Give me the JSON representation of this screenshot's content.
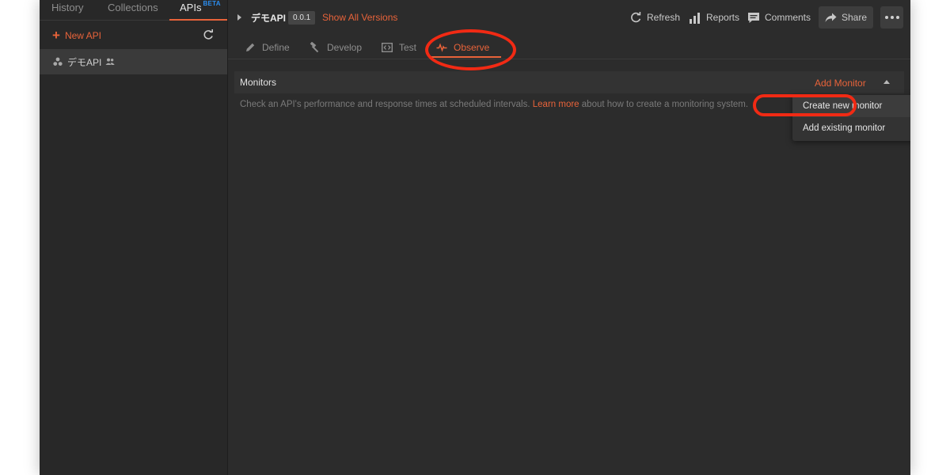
{
  "sidebar": {
    "tabs": {
      "history": "History",
      "collections": "Collections",
      "apis": "APIs",
      "apis_badge": "BETA"
    },
    "new_api": "New API",
    "api_items": [
      {
        "name": "デモAPI",
        "shared": true
      }
    ]
  },
  "header": {
    "api_name": "デモAPI",
    "version": "0.0.1",
    "show_all_versions": "Show All Versions",
    "actions": {
      "refresh": "Refresh",
      "reports": "Reports",
      "comments": "Comments",
      "share": "Share"
    }
  },
  "subtabs": {
    "define": "Define",
    "develop": "Develop",
    "test": "Test",
    "observe": "Observe",
    "active": "observe"
  },
  "monitors": {
    "title": "Monitors",
    "add_monitor": "Add Monitor",
    "description_pre": "Check an API's performance and response times at scheduled intervals.",
    "learn_more": "Learn more",
    "description_post": "about how to create a monitoring system."
  },
  "dropdown": {
    "create_new": "Create new monitor",
    "add_existing": "Add existing monitor"
  },
  "colors": {
    "accent": "#e8633a",
    "beta": "#2b8ef0",
    "annotation": "#f12a14",
    "background": "#2c2c2c"
  }
}
